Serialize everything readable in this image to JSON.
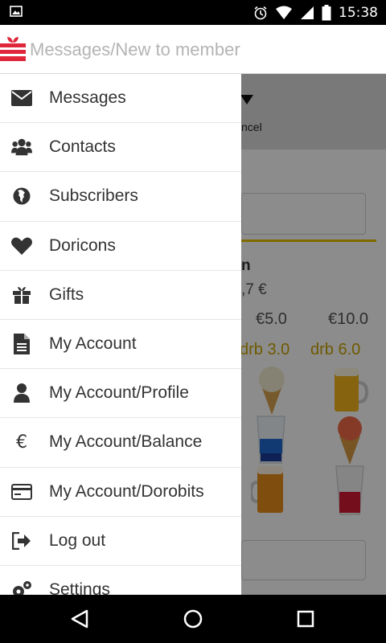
{
  "status_bar": {
    "time": "15:38",
    "icons": [
      "image-icon",
      "alarm-icon",
      "wifi-icon",
      "signal-icon",
      "battery-icon"
    ]
  },
  "action_bar": {
    "logo_icon": "gift-logo-icon",
    "title": "Messages/New to member",
    "accent_color": "#e0263a"
  },
  "background": {
    "cancel_label": "ncel",
    "name_text": "n",
    "amount_text": ",7 €",
    "prices": [
      "€5.0",
      "€10.0"
    ],
    "drb_values": [
      "drb 3.0",
      "drb 6.0"
    ],
    "drb_color": "#c9a400",
    "drinks": [
      "ice-cream-icon",
      "beer-mug-icon",
      "blue-shot-icon",
      "ice-cream-icon",
      "beer-glass-icon",
      "red-shot-icon"
    ]
  },
  "drawer": {
    "items": [
      {
        "label": "Messages",
        "icon": "envelope-icon"
      },
      {
        "label": "Contacts",
        "icon": "users-icon"
      },
      {
        "label": "Subscribers",
        "icon": "globe-icon"
      },
      {
        "label": "Doricons",
        "icon": "heart-icon"
      },
      {
        "label": "Gifts",
        "icon": "gift-icon"
      },
      {
        "label": "My Account",
        "icon": "document-icon"
      },
      {
        "label": "My Account/Profile",
        "icon": "person-icon"
      },
      {
        "label": "My Account/Balance",
        "icon": "euro-icon"
      },
      {
        "label": "My Account/Dorobits",
        "icon": "credit-card-icon"
      },
      {
        "label": "Log out",
        "icon": "logout-icon"
      },
      {
        "label": "Settings",
        "icon": "gears-icon"
      }
    ]
  },
  "nav_bar": {
    "buttons": [
      "back-icon",
      "home-icon",
      "recents-icon"
    ]
  }
}
